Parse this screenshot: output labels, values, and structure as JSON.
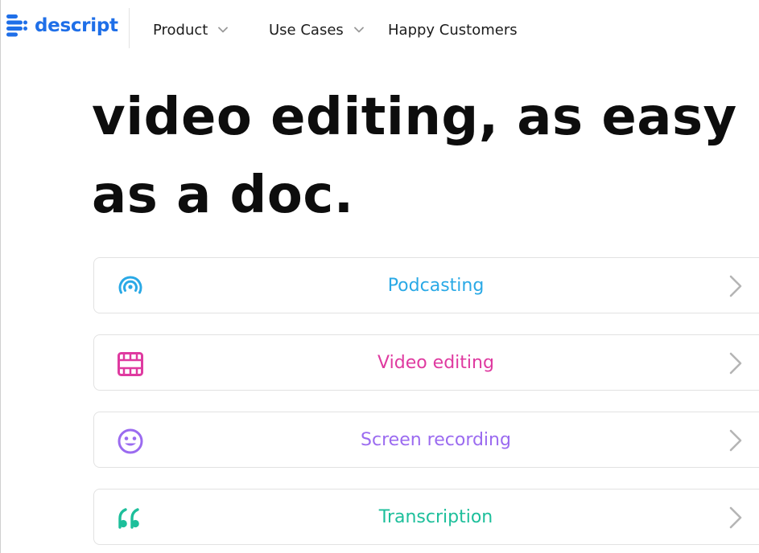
{
  "header": {
    "logo_text": "descript",
    "nav": [
      {
        "label": "Product",
        "icon": "chevron-down-icon"
      },
      {
        "label": "Use Cases",
        "icon": "chevron-down-icon"
      },
      {
        "label": "Happy Customers"
      }
    ]
  },
  "hero": {
    "line1": "video editing, as easy",
    "line2": "as a doc."
  },
  "use_cases": [
    {
      "label": "Podcasting",
      "icon": "podcast-icon",
      "color": "#2aa9e6"
    },
    {
      "label": "Video editing",
      "icon": "film-icon",
      "color": "#df3aa0"
    },
    {
      "label": "Screen recording",
      "icon": "smiley-icon",
      "color": "#9b6bf0"
    },
    {
      "label": "Transcription",
      "icon": "quote-icon",
      "color": "#1dbf9b"
    }
  ],
  "colors": {
    "brand": "#1f6fe8",
    "chevron": "#b5b5b5",
    "card_border": "#e2e2e2"
  }
}
